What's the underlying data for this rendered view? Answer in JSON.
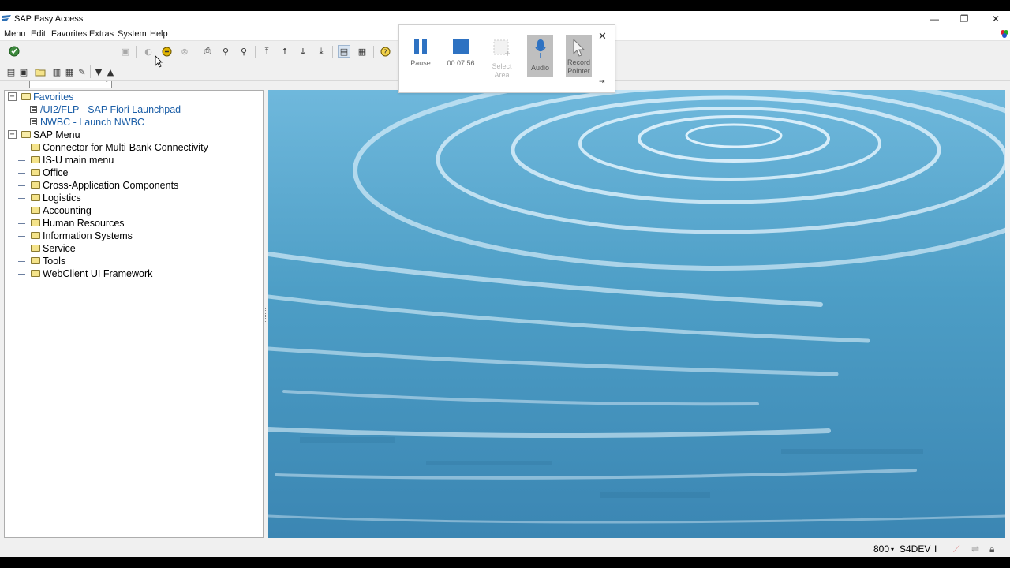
{
  "window": {
    "title": "SAP Easy Access",
    "minimize": "—",
    "restore": "❐",
    "close": "✕"
  },
  "menu": [
    "Menu",
    "Edit",
    "Favorites",
    "Extras",
    "System",
    "Help"
  ],
  "command_field": {
    "value": ""
  },
  "tree": {
    "favorites": {
      "label": "Favorites",
      "items": [
        "/UI2/FLP - SAP Fiori Launchpad",
        "NWBC - Launch NWBC"
      ]
    },
    "sap_menu": {
      "label": "SAP Menu",
      "items": [
        "Connector for Multi-Bank Connectivity",
        "IS-U main menu",
        "Office",
        "Cross-Application Components",
        "Logistics",
        "Accounting",
        "Human Resources",
        "Information Systems",
        "Service",
        "Tools",
        "WebClient UI Framework"
      ]
    }
  },
  "recorder": {
    "pause": "Pause",
    "time": "00:07:56",
    "select_area_1": "Select",
    "select_area_2": "Area",
    "audio": "Audio",
    "record_pointer_1": "Record",
    "record_pointer_2": "Pointer",
    "close": "✕",
    "pin": "⇥"
  },
  "status": {
    "client": "800",
    "system": "S4DEV",
    "mode": "I"
  },
  "colors": {
    "link": "#1a5da6",
    "water": "#4d9ec6",
    "recorder_active": "#bfbfbf"
  }
}
